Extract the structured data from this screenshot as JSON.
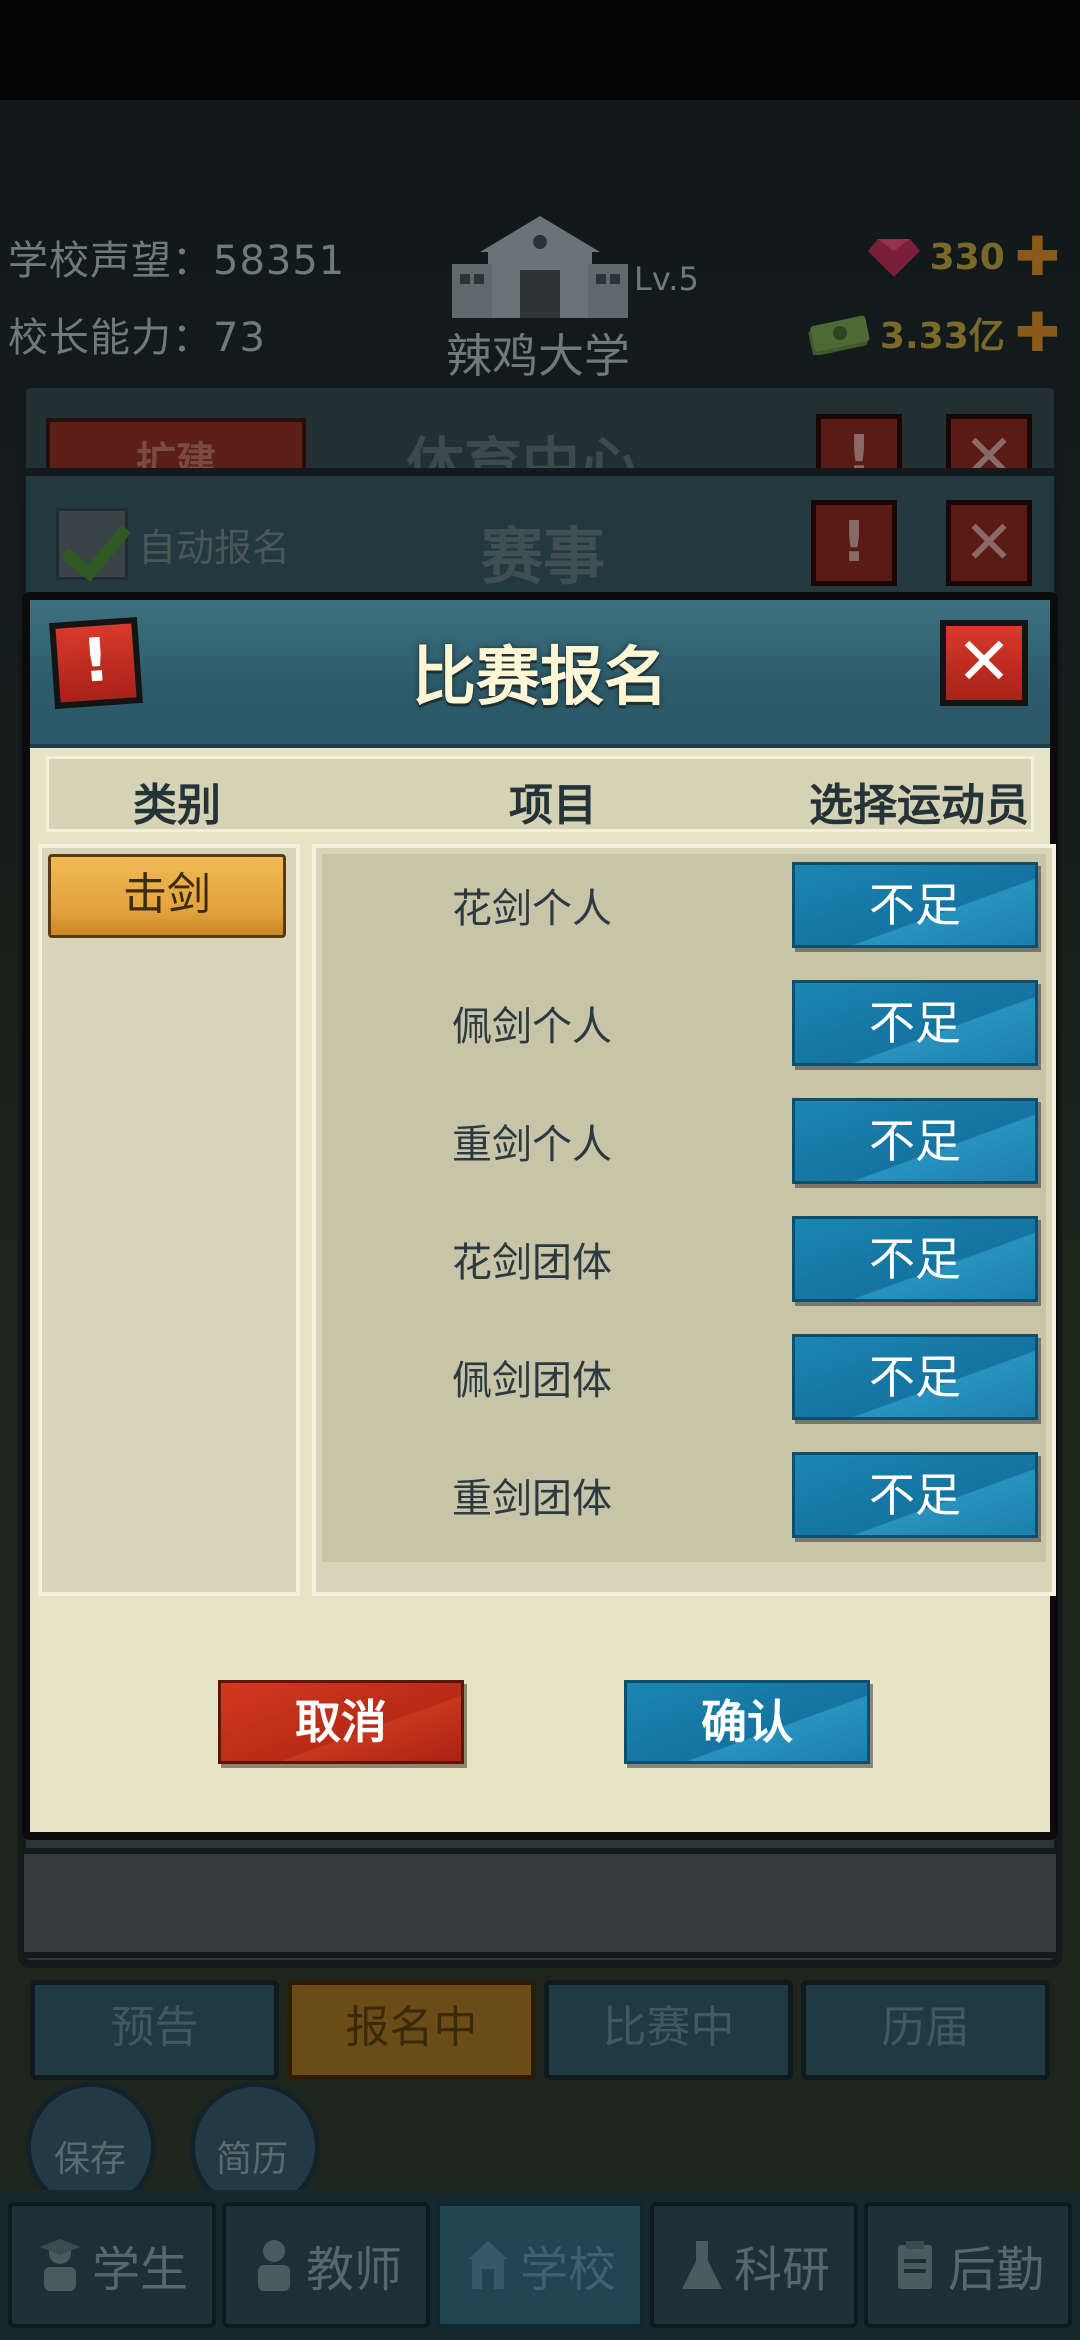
{
  "hud": {
    "reputation": "学校声望：58351",
    "ability": "校长能力：73",
    "school_level": "Lv.5",
    "school_name": "辣鸡大学",
    "gems": "330",
    "money": "3.33亿"
  },
  "back_panels": {
    "facility_title": "体育中心",
    "expand_label": "扩建",
    "events_title": "赛事",
    "auto_signup": "自动报名"
  },
  "dialog": {
    "title": "比赛报名",
    "columns": {
      "category": "类别",
      "item": "项目",
      "athlete": "选择运动员"
    },
    "categories": [
      {
        "label": "击剑",
        "selected": true
      }
    ],
    "items": [
      {
        "name": "花剑个人",
        "button": "不足"
      },
      {
        "name": "佩剑个人",
        "button": "不足"
      },
      {
        "name": "重剑个人",
        "button": "不足"
      },
      {
        "name": "花剑团体",
        "button": "不足"
      },
      {
        "name": "佩剑团体",
        "button": "不足"
      },
      {
        "name": "重剑团体",
        "button": "不足"
      }
    ],
    "cancel_label": "取消",
    "confirm_label": "确认"
  },
  "event_tabs": [
    {
      "label": "预告",
      "active": false
    },
    {
      "label": "报名中",
      "active": true
    },
    {
      "label": "比赛中",
      "active": false
    },
    {
      "label": "历届",
      "active": false
    }
  ],
  "side_buttons": {
    "save": "保存",
    "resume": "简历"
  },
  "bottom_nav": [
    {
      "label": "学生",
      "icon": "student-icon",
      "active": false
    },
    {
      "label": "教师",
      "icon": "teacher-icon",
      "active": false
    },
    {
      "label": "学校",
      "icon": "school-icon",
      "active": true
    },
    {
      "label": "科研",
      "icon": "research-icon",
      "active": false
    },
    {
      "label": "后勤",
      "icon": "logistics-icon",
      "active": false
    }
  ],
  "colors": {
    "dialog_bg": "#e6e3c6",
    "header_teal": "#2d5d6b",
    "button_blue": "#1b86b3",
    "button_red": "#c9371f",
    "category_gold": "#e2a23c"
  }
}
